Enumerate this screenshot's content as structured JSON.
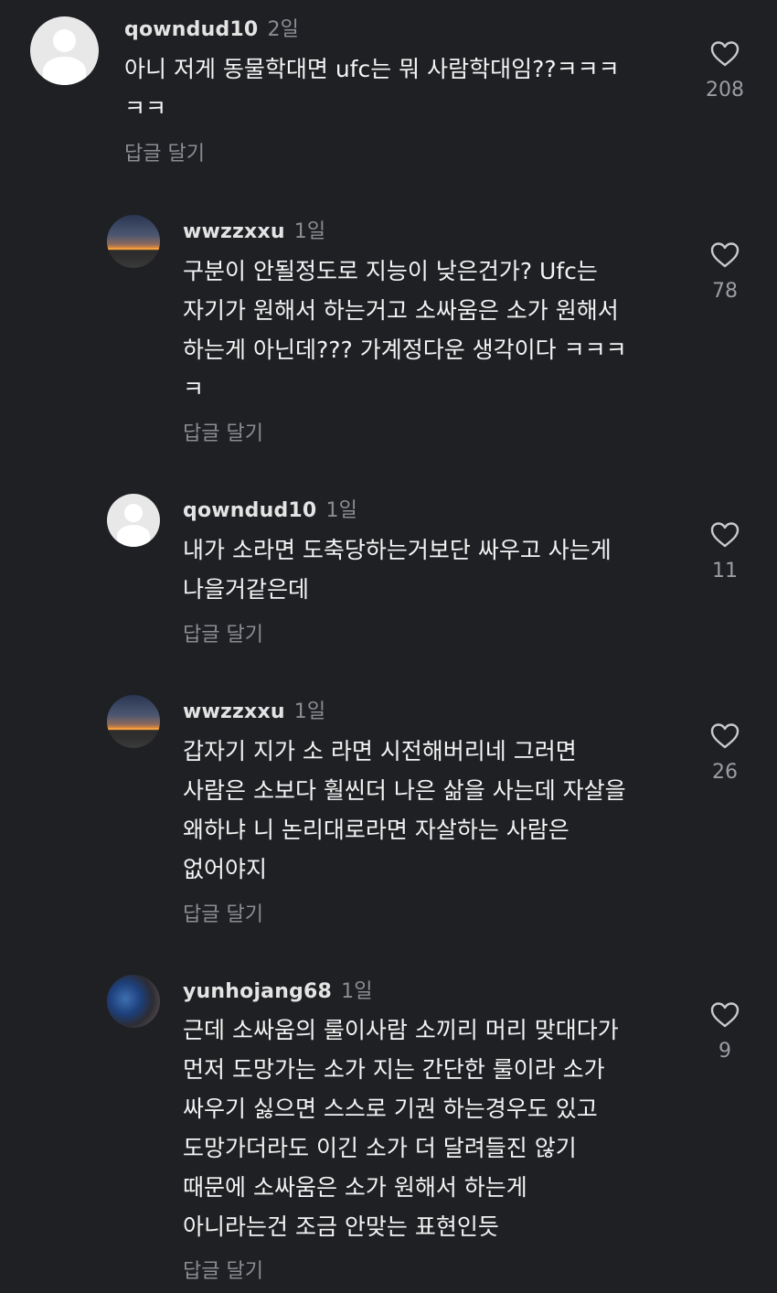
{
  "comments": [
    {
      "username": "qowndud10",
      "time": "2일",
      "lines": [
        "아니 저게 동물학대면 ufc는 뭐 사람학대임??ㅋㅋㅋ",
        "ㅋㅋ"
      ],
      "reply_label": "답글 달기",
      "likes": "208",
      "avatar": "default-avatar"
    },
    {
      "username": "wwzzxxu",
      "time": "1일",
      "lines": [
        "구분이 안될정도로 지능이 낮은건가? Ufc는",
        "자기가 원해서 하는거고 소싸움은 소가 원해서",
        "하는게 아닌데??? 가계정다운 생각이다 ㅋㅋㅋ",
        "ㅋ"
      ],
      "reply_label": "답글 달기",
      "likes": "78",
      "avatar": "sunset-avatar"
    },
    {
      "username": "qowndud10",
      "time": "1일",
      "lines": [
        "내가 소라면 도축당하는거보단 싸우고 사는게",
        "나을거같은데"
      ],
      "reply_label": "답글 달기",
      "likes": "11",
      "avatar": "default-avatar"
    },
    {
      "username": "wwzzxxu",
      "time": "1일",
      "lines": [
        "갑자기 지가 소 라면 시전해버리네 그러면",
        "사람은 소보다 훨씬더 나은 삶을 사는데 자살을",
        "왜하냐 니 논리대로라면 자살하는 사람은",
        "없어야지"
      ],
      "reply_label": "답글 달기",
      "likes": "26",
      "avatar": "sunset-avatar"
    },
    {
      "username": "yunhojang68",
      "time": "1일",
      "lines": [
        "근데 소싸움의 룰이사람 소끼리 머리 맞대다가",
        "먼저 도망가는 소가 지는 간단한 룰이라 소가",
        "싸우기 싫으면 스스로 기권 하는경우도 있고",
        "도망가더라도 이긴 소가 더 달려들진 않기",
        "때문에 소싸움은 소가 원해서 하는게",
        "아니라는건 조금 안맞는 표현인듯"
      ],
      "reply_label": "답글 달기",
      "likes": "9",
      "avatar": "photo-avatar"
    }
  ],
  "colors": {
    "background": "#1f2023",
    "text": "#f4f4f4",
    "muted": "#8b8d93",
    "heart": "#c8c9cc"
  },
  "icons": {
    "like": "heart-outline-icon"
  }
}
